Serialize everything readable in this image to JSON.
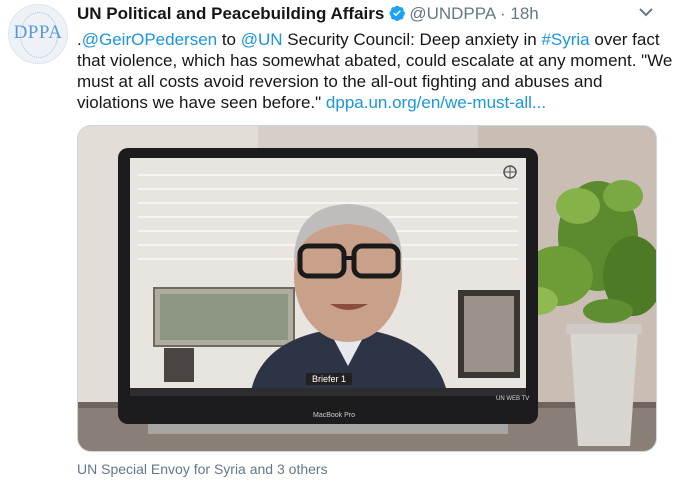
{
  "tweet": {
    "author_name": "UN Political and Peacebuilding Affairs",
    "handle": "@UNDPPA",
    "separator": "·",
    "timestamp": "18h",
    "avatar_text": "DPPA",
    "text_segments": {
      "prefix": ".",
      "mention1": "@GeirOPedersen",
      "to": " to ",
      "mention2": "@UN",
      "part1": " Security Council: Deep anxiety in ",
      "hashtag": "#Syria",
      "part2": " over fact that violence, which has somewhat abated, could escalate at any moment. \"We must at all costs avoid reversion to the all-out fighting and abuses and violations we have seen before.\" ",
      "link": "dppa.un.org/en/we-must-all..."
    },
    "media": {
      "name_tag": "Briefer 1",
      "laptop_brand": "MacBook Pro",
      "tv_label": "UN WEB TV"
    },
    "tagged": "UN Special Envoy for Syria and 3 others"
  },
  "colors": {
    "link": "#1b95e0",
    "secondary_text": "#657786",
    "verified": "#1da1f2"
  },
  "icons": [
    "verified-badge-icon",
    "chevron-down-icon",
    "un-emblem-icon"
  ]
}
